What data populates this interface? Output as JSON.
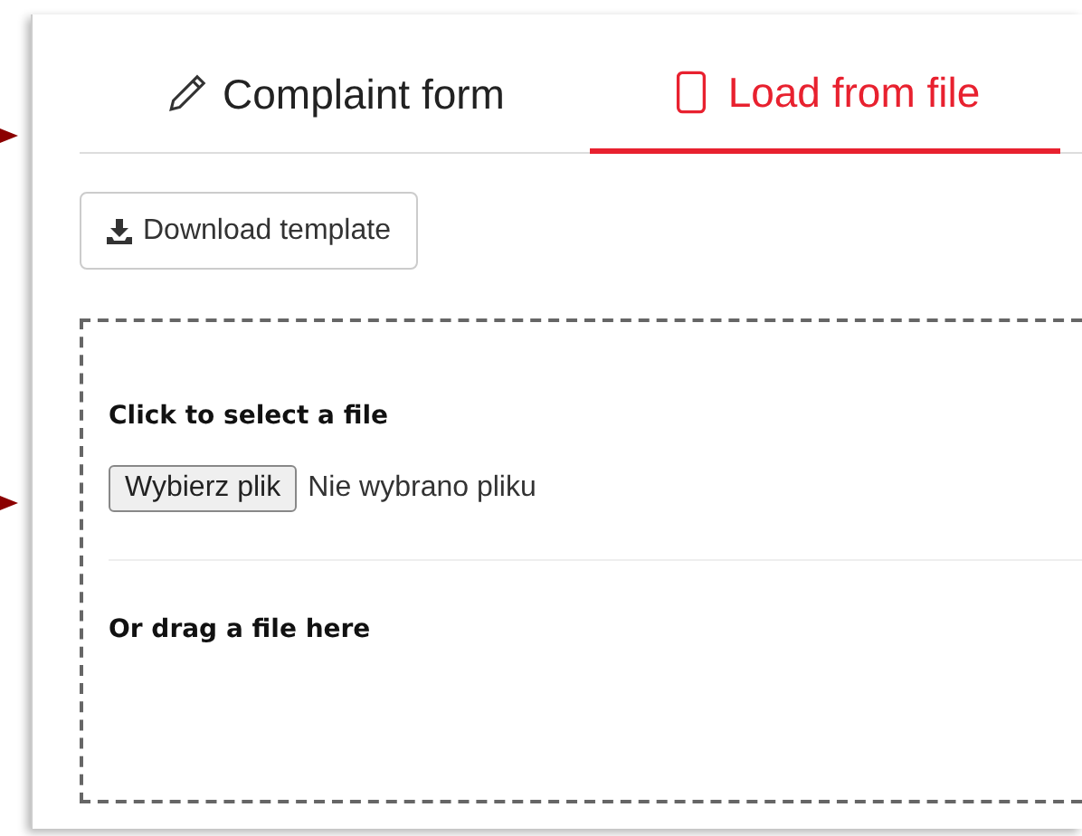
{
  "tabs": [
    {
      "label": "Complaint form",
      "kind": "pencil",
      "selected": false
    },
    {
      "label": "Load from file",
      "kind": "file",
      "selected": true
    }
  ],
  "download_button": {
    "label": "Download template"
  },
  "drop_zone": {
    "select_label": "Click to select a file",
    "file_button": "Wybierz plik",
    "file_status": "Nie wybrano pliku",
    "drag_label": "Or drag a file here"
  }
}
